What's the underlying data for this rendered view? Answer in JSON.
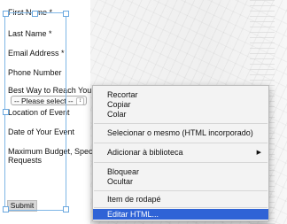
{
  "form": {
    "fields": [
      {
        "label": "First Name *"
      },
      {
        "label": "Last Name *"
      },
      {
        "label": "Email Address *"
      },
      {
        "label": "Phone Number"
      },
      {
        "label": "Best Way to Reach You"
      },
      {
        "label": "Location of Event"
      },
      {
        "label": "Date of Your Event"
      },
      {
        "label": "Maximum Budget, Spec"
      },
      {
        "label": "Requests"
      }
    ],
    "select_value": "-- Please select --",
    "submit_label": "Submit"
  },
  "context_menu": {
    "items": [
      {
        "label": "Recortar"
      },
      {
        "label": "Copiar"
      },
      {
        "label": "Colar"
      },
      {
        "label": "Selecionar o mesmo (HTML incorporado)"
      },
      {
        "label": "Adicionar à biblioteca",
        "submenu": "▶"
      },
      {
        "label": "Bloquear"
      },
      {
        "label": "Ocultar"
      },
      {
        "label": "Item de rodapé"
      },
      {
        "label": "Editar HTML..."
      }
    ]
  }
}
